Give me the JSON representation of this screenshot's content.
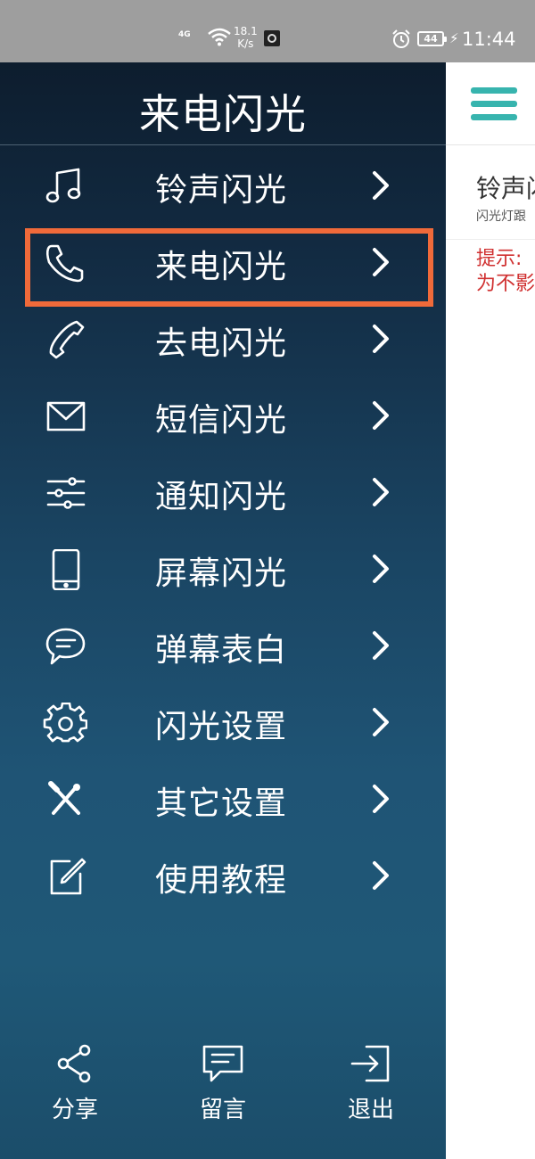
{
  "status_bar": {
    "network": "4G",
    "speed_value": "18.1",
    "speed_unit": "K/s",
    "battery": "44",
    "time": "11:44"
  },
  "drawer": {
    "title": "来电闪光",
    "highlight_color": "#f06a3a",
    "items": [
      {
        "label": "铃声闪光",
        "icon": "music-note-icon"
      },
      {
        "label": "来电闪光",
        "icon": "phone-icon"
      },
      {
        "label": "去电闪光",
        "icon": "handset-icon"
      },
      {
        "label": "短信闪光",
        "icon": "envelope-icon"
      },
      {
        "label": "通知闪光",
        "icon": "sliders-icon"
      },
      {
        "label": "屏幕闪光",
        "icon": "smartphone-icon"
      },
      {
        "label": "弹幕表白",
        "icon": "chat-bubble-icon"
      },
      {
        "label": "闪光设置",
        "icon": "gear-icon"
      },
      {
        "label": "其它设置",
        "icon": "tools-icon"
      },
      {
        "label": "使用教程",
        "icon": "edit-icon"
      }
    ],
    "bottom": {
      "share": "分享",
      "message": "留言",
      "exit": "退出"
    }
  },
  "content": {
    "accent": "#37b4ae",
    "title": "铃声闪",
    "subtitle": "闪光灯跟",
    "tip_line1": "提示:",
    "tip_line2": "为不影"
  }
}
